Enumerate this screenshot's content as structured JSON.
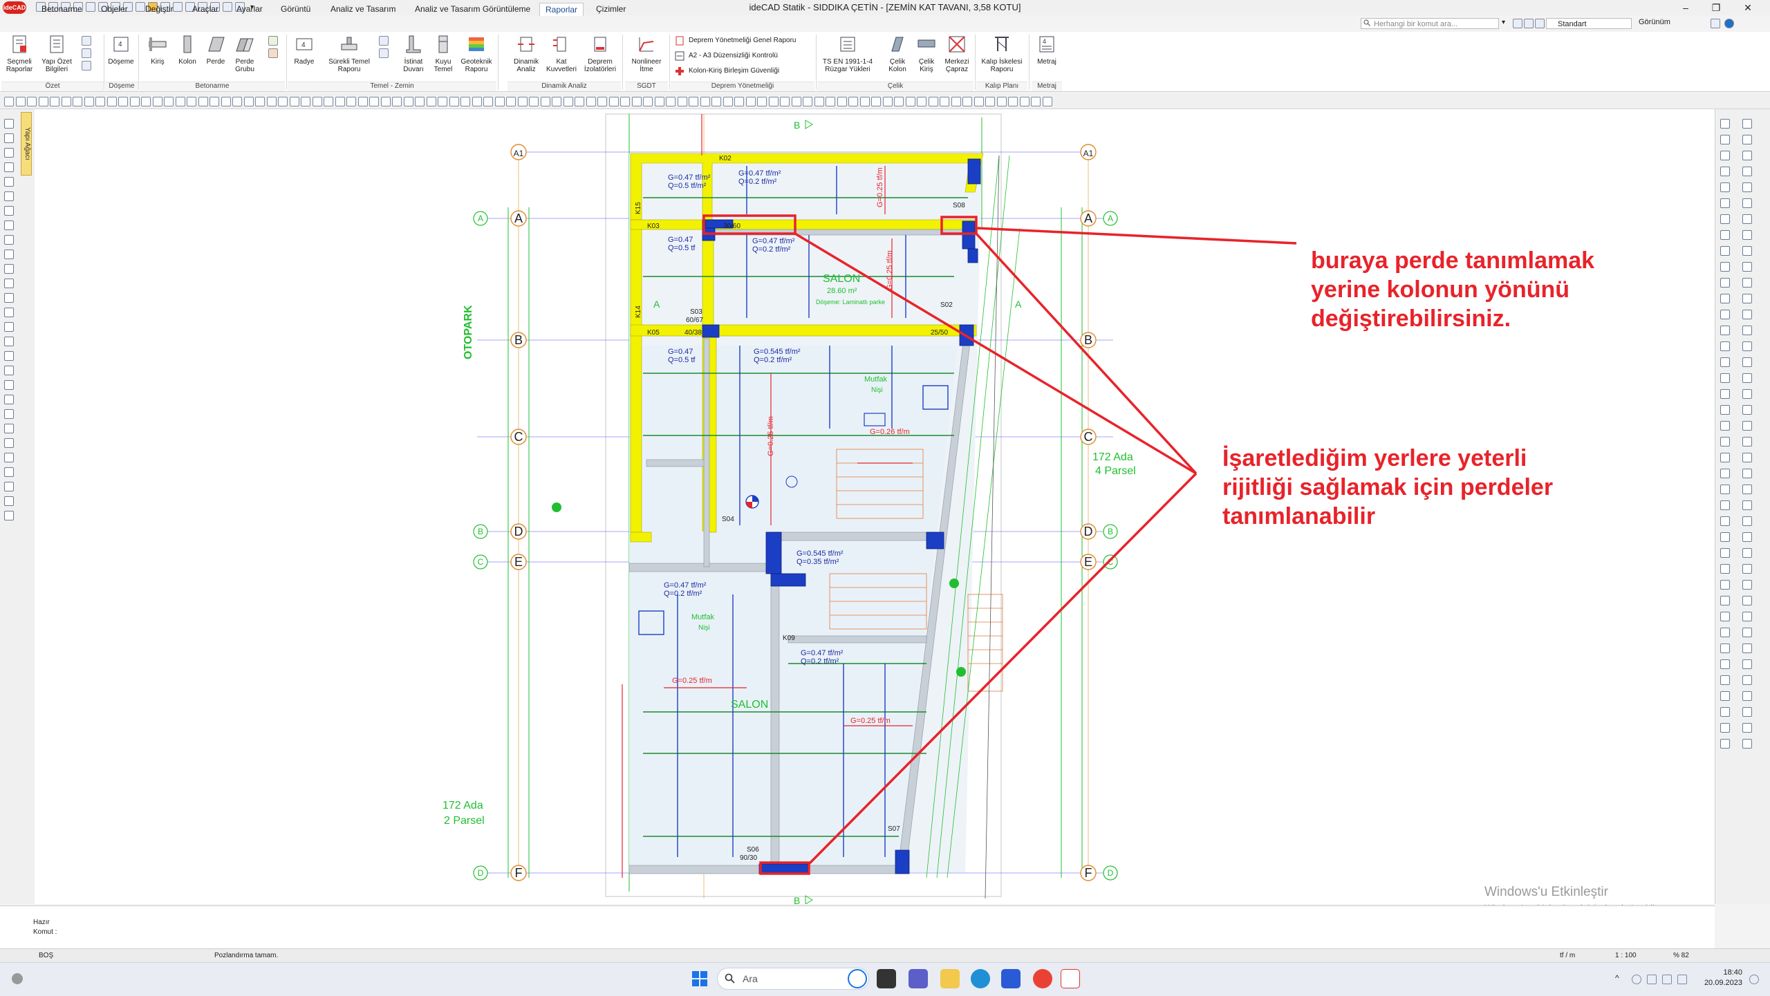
{
  "window": {
    "title": "ideCAD Statik - SIDDIKA ÇETİN - [ZEMİN KAT TAVANI,  3,58 KOTU]",
    "logo": "ideCAD",
    "controls": {
      "minimize": "–",
      "maximize": "❐",
      "close": "✕"
    }
  },
  "tabs": [
    {
      "label": "Betonarme"
    },
    {
      "label": "Objeler"
    },
    {
      "label": "Değiştir"
    },
    {
      "label": "Araçlar"
    },
    {
      "label": "Ayarlar"
    },
    {
      "label": "Görüntü"
    },
    {
      "label": "Analiz ve Tasarım"
    },
    {
      "label": "Analiz ve Tasarım Görüntüleme"
    },
    {
      "label": "Raporlar"
    },
    {
      "label": "Çizimler"
    }
  ],
  "active_tab": "Raporlar",
  "command_search": {
    "placeholder": "Herhangi bir komut ara..."
  },
  "style_select": {
    "value": "Standart"
  },
  "view_menu": {
    "label": "Görünüm"
  },
  "ribbon": {
    "groups": [
      {
        "label": "Özet",
        "buttons": [
          "Seçmeli\nRaporlar",
          "Yapı Özet\nBilgileri"
        ]
      },
      {
        "label": "Döşeme",
        "buttons": [
          "Döşeme"
        ]
      },
      {
        "label": "Betonarme",
        "buttons": [
          "Kiriş",
          "Kolon",
          "Perde",
          "Perde\nGrubu"
        ]
      },
      {
        "label": "Temel - Zemin",
        "buttons": [
          "Radye",
          "Sürekli Temel\nRaporu",
          "İstinat\nDuvarı",
          "Kuyu\nTemel",
          "Geoteknik\nRaporu"
        ]
      },
      {
        "label": "Dinamik Analiz",
        "buttons": [
          "Dinamik\nAnaliz",
          "Kat\nKuvvetleri",
          "Deprem\nİzolatörleri"
        ]
      },
      {
        "label": "SGDT",
        "buttons": [
          "Nonlineer\nİtme"
        ]
      },
      {
        "label": "Deprem Yönetmeliği",
        "items": [
          "Deprem Yönetmeliği Genel Raporu",
          "A2 - A3 Düzensizliği Kontrolü",
          "Kolon-Kiriş Birleşim Güvenliği"
        ]
      },
      {
        "label": "Çelik",
        "buttons": [
          "TS EN 1991-1-4\nRüzgar Yükleri",
          "Çelik\nKolon",
          "Çelik\nKiriş",
          "Merkezi\nÇapraz"
        ]
      },
      {
        "label": "Kalıp Planı",
        "buttons": [
          "Kalıp İskelesi\nRaporu"
        ]
      },
      {
        "label": "Metraj",
        "buttons": [
          "Metraj"
        ]
      }
    ]
  },
  "left_panel": {
    "tab_label": "Yapı Ağacı"
  },
  "drawing": {
    "axes_rows": [
      "A1",
      "A",
      "B",
      "C",
      "D",
      "E",
      "F"
    ],
    "axis_markers_outer": [
      "A",
      "B",
      "C",
      "D"
    ],
    "section_markers": [
      "B",
      "A"
    ],
    "labels": {
      "otopark": "OTOPARK",
      "parcel_right_1": "172 Ada",
      "parcel_right_2": "4 Parsel",
      "parcel_left_1": "172 Ada",
      "parcel_left_2": "2 Parsel",
      "salon_top": "SALON",
      "salon_top_area": "28.60 m²",
      "salon_top_info": "Döşeme: Laminatlı parke",
      "salon_bottom": "SALON",
      "mutfak_top": "Mutfak",
      "mutfak_top_sub": "Nişi",
      "mutfak_bottom": "Mutfak",
      "mutfak_bottom_sub": "Nişi",
      "load_1a": "G=0.47 tf/m²",
      "load_1b": "Q=0.2 tf/m²",
      "load_2a": "G=0.47 tf/m²",
      "load_2b": "Q=0.5 tf/m²",
      "load_3a": "G=0.47 tf/m²",
      "load_3b": "Q=0.2 tf/m²",
      "load_4a": "G=0.47",
      "load_4b": "Q=0.5 tf",
      "load_5a": "G=0.545 tf/m²",
      "load_5b": "Q=0.2 tf/m²",
      "load_6a": "G=0.47",
      "load_6b": "Q=0.5 tf",
      "load_7a": "G=0.545 tf/m²",
      "load_7b": "Q=0.35 tf/m²",
      "load_8a": "G=0.47 tf/m²",
      "load_8b": "Q=0.2 tf/m²",
      "load_9a": "G=0.47 tf/m²",
      "load_9b": "Q=0.2 tf/m²",
      "line_load_1": "G=0.25 tf/m",
      "line_load_2": "G=0.25 tf/m",
      "line_load_3": "G=0.25 tf/m",
      "line_load_4": "G=0.26 tf/m",
      "line_load_5": "G=0.25 tf/m",
      "line_load_6": "G=0.25 tf/m",
      "beam_K02": "K02",
      "beam_K03": "K03",
      "beam_K05": "K05",
      "beam_K09": "K09",
      "beam_K14": "K14",
      "beam_K15": "K15",
      "slab_S02": "S02",
      "slab_S03": "S03",
      "slab_S04": "S04",
      "slab_S06": "S06",
      "slab_S07": "S07",
      "slab_S08": "S08",
      "slab_S03b": "60/67",
      "col_dim_1": "30/60",
      "col_dim_2": "40/38",
      "col_dim_3": "25/50",
      "col_dim_4": "90/30"
    }
  },
  "annotations": {
    "note_1": "buraya perde tanımlamak\nyerine kolonun yönünü\ndeğiştirebilirsiniz.",
    "note_2": "İşaretlediğim yerlere yeterli\nrijitliği sağlamak için perdeler\ntanımlanabilir",
    "color": "#e8232a"
  },
  "command_area": {
    "line_1": "Hazır",
    "line_2": "Komut :"
  },
  "status_bar": {
    "left": "BOŞ",
    "message": "Pozlandırma tamam.",
    "unit": "tf / m",
    "scale": "1 : 100",
    "zoom": "% 82"
  },
  "activation": {
    "title": "Windows'u Etkinleştir",
    "subtitle": "Windows'u etkinleştirmek için Ayarlar'a gidin."
  },
  "taskbar": {
    "search_placeholder": "Ara",
    "time": "18:40",
    "date": "20.09.2023"
  },
  "colors": {
    "yellow": "#f2f200",
    "blue_column": "#1b3fc4",
    "axis_green": "#1fbf2f",
    "axis_orange": "#e08a2a",
    "red_line": "#e8232a"
  }
}
